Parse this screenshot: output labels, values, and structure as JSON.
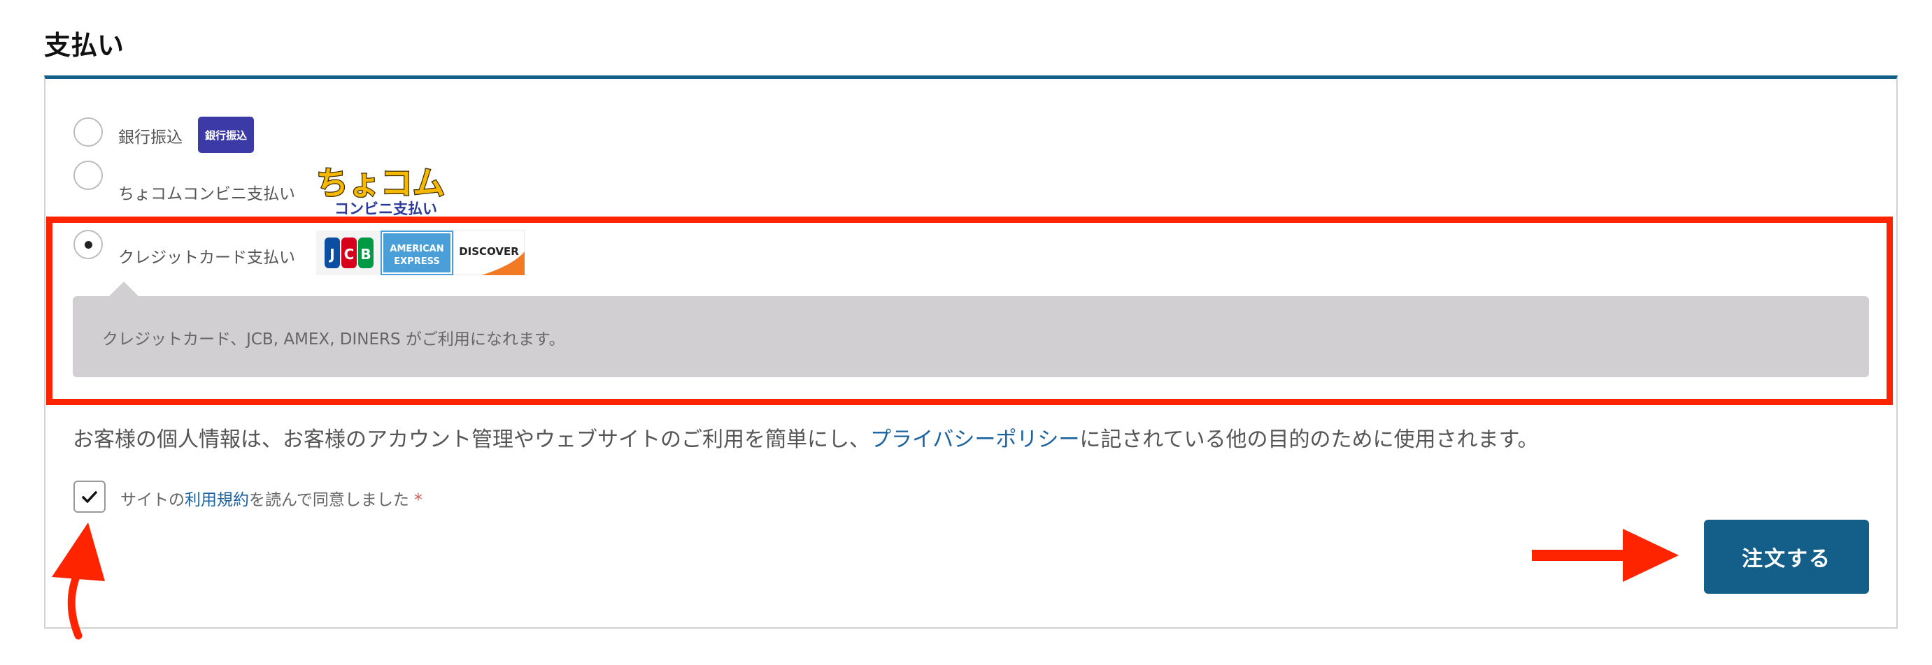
{
  "section": {
    "title": "支払い"
  },
  "payment_methods": [
    {
      "label": "銀行振込",
      "logo_text": "銀行振込",
      "selected": false
    },
    {
      "label": "ちょコムコンビニ支払い",
      "logo_text": "ちょコム",
      "logo_subtext": "コンビニ支払い",
      "selected": false
    },
    {
      "label": "クレジットカード支払い",
      "selected": true,
      "card_logos": [
        "JCB",
        "AMERICAN EXPRESS",
        "DISCOVER"
      ]
    }
  ],
  "credit_info": {
    "text": "クレジットカード、JCB, AMEX, DINERS がご利用になれます。"
  },
  "privacy": {
    "before": "お客様の個人情報は、お客様のアカウント管理やウェブサイトのご利用を簡単にし、",
    "link": "プライバシーポリシー",
    "after": "に記されている他の目的のために使用されます。"
  },
  "terms": {
    "before": "サイトの",
    "link": "利用規約",
    "after": "を読んで同意しました",
    "required_mark": "*",
    "checked": true
  },
  "order_button": {
    "label": "注文する"
  },
  "colors": {
    "accent": "#135f8a",
    "link": "#1a62a0",
    "annotation": "#ff2400",
    "info_panel": "#d2cfd3"
  }
}
